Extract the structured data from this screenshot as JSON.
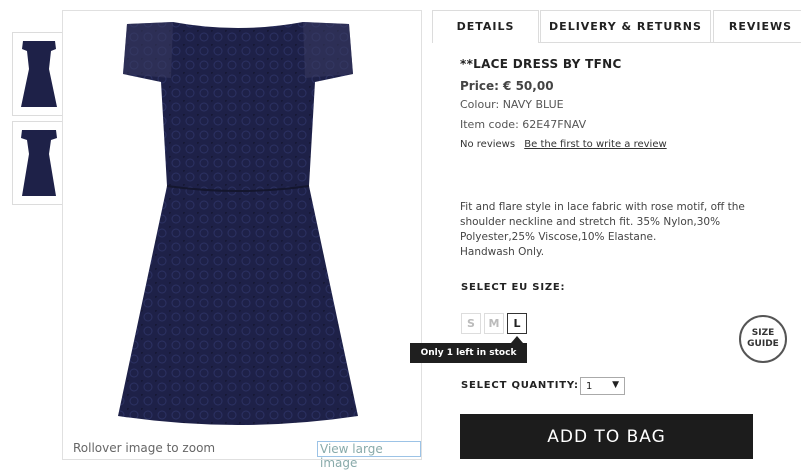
{
  "images": {
    "thumbnails": [
      {
        "icon": "dress-front-thumbnail"
      },
      {
        "icon": "dress-back-thumbnail"
      }
    ],
    "main_icon": "navy-lace-dress-image",
    "rollover_hint": "Rollover image to zoom",
    "view_large_label": "View large image"
  },
  "tabs": [
    {
      "label": "DETAILS",
      "active": true
    },
    {
      "label": "DELIVERY & RETURNS",
      "active": false
    },
    {
      "label": "REVIEWS",
      "active": false
    }
  ],
  "product": {
    "title": "**LACE DRESS BY TFNC",
    "price": "Price: € 50,00",
    "colour": "Colour: NAVY BLUE",
    "item_code": "Item code: 62E47FNAV",
    "reviews_count": "No reviews",
    "write_review": "Be the first to write a review",
    "description_lines": [
      "Fit and flare style in lace fabric with rose motif, off the",
      "shoulder neckline and stretch fit. 35% Nylon,30%",
      "Polyester,25% Viscose,10% Elastane.",
      "Handwash Only."
    ]
  },
  "size": {
    "label": "SELECT EU SIZE:",
    "options": [
      "S",
      "M",
      "L"
    ],
    "available": "L",
    "stock_tooltip": "Only 1 left in stock",
    "guide_line1": "SIZE",
    "guide_line2": "GUIDE"
  },
  "quantity": {
    "label": "SELECT QUANTITY:",
    "value": "1"
  },
  "cta": {
    "add_to_bag": "ADD TO BAG"
  },
  "colors": {
    "dress": "#1e2148",
    "button": "#1c1c1c"
  }
}
